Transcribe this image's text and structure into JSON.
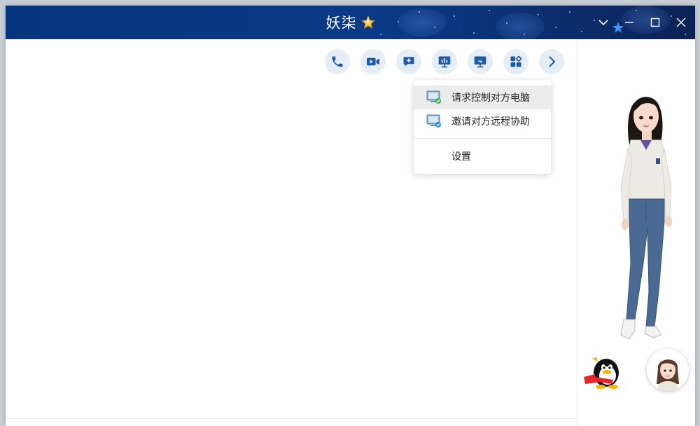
{
  "window": {
    "title": "妖柒"
  },
  "toolbar": {
    "buttons": [
      {
        "name": "voice-call-button",
        "icon": "phone-icon"
      },
      {
        "name": "video-call-button",
        "icon": "video-camera-icon"
      },
      {
        "name": "start-group-chat-button",
        "icon": "chat-plus-icon"
      },
      {
        "name": "screen-share-button",
        "icon": "presentation-icon"
      },
      {
        "name": "remote-desktop-button",
        "icon": "remote-monitor-icon"
      },
      {
        "name": "apps-button",
        "icon": "apps-grid-icon"
      },
      {
        "name": "more-button",
        "icon": "chevron-right-icon"
      }
    ]
  },
  "menu": {
    "items": [
      {
        "label": "请求控制对方电脑",
        "icon": "monitor-control-icon",
        "highlighted": true
      },
      {
        "label": "邀请对方远程协助",
        "icon": "monitor-assist-icon",
        "highlighted": false
      },
      {
        "label": "设置",
        "icon": "",
        "highlighted": false
      }
    ]
  },
  "colors": {
    "titlebar": "#06357f",
    "accent": "#1e5aa8",
    "tool_bg": "#e5edf6"
  }
}
